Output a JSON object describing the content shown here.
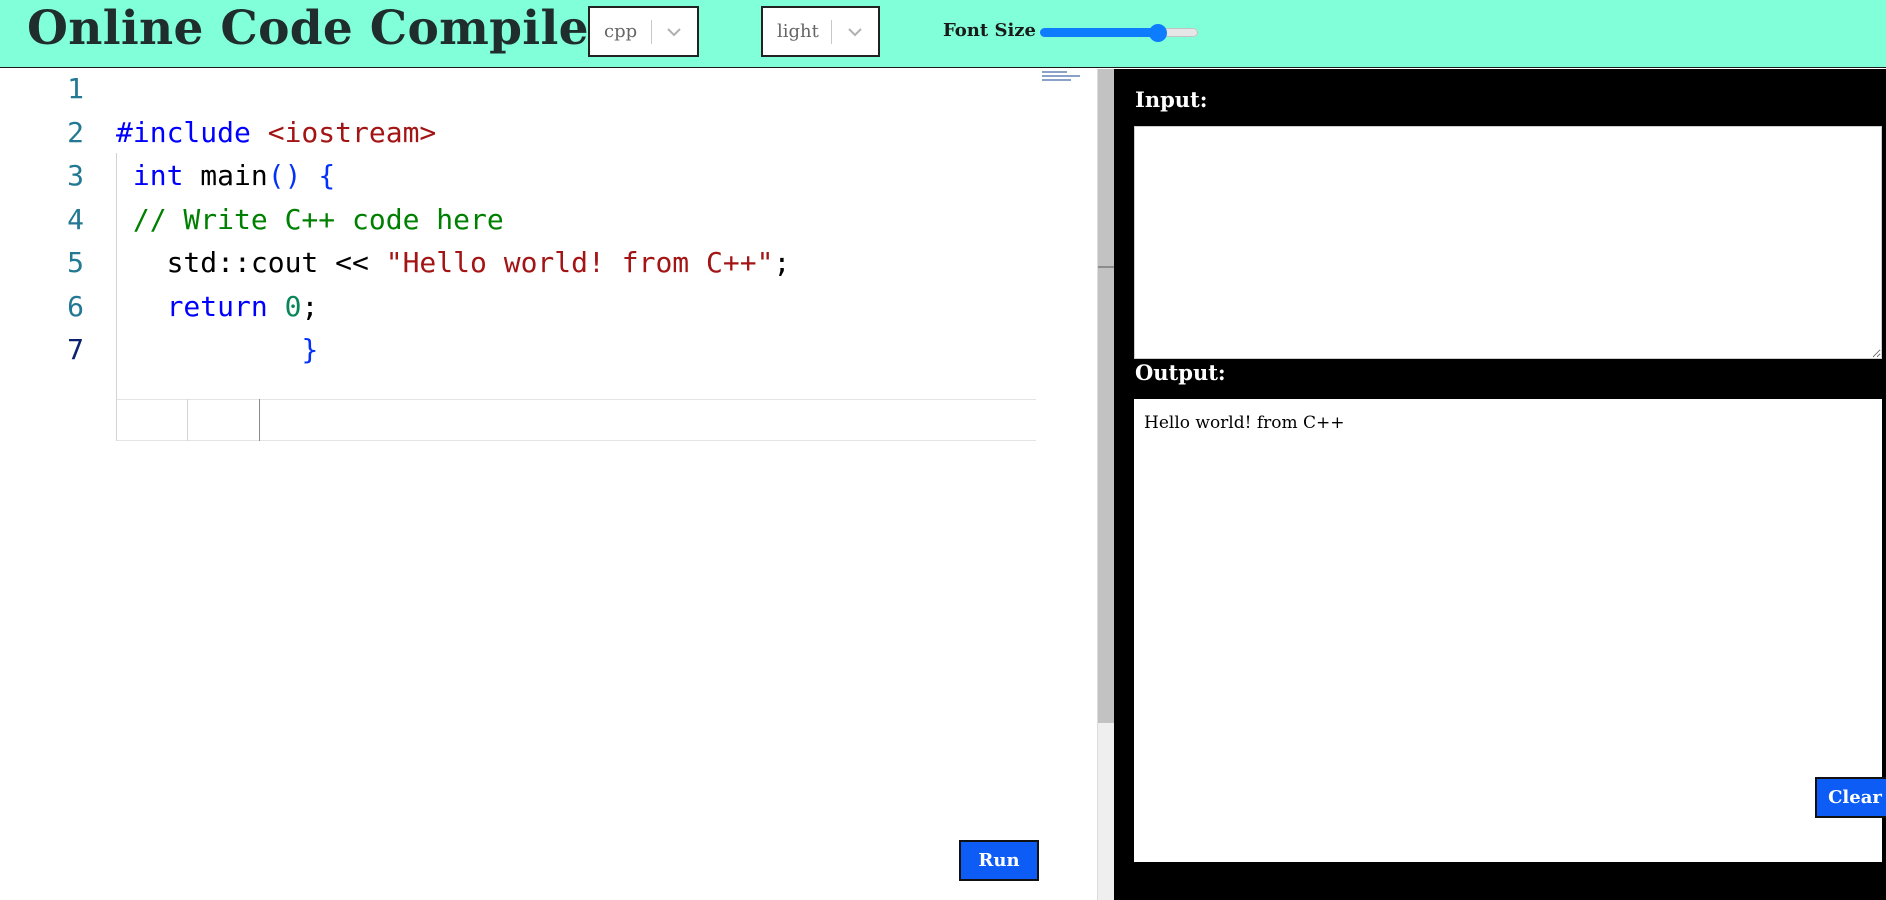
{
  "header": {
    "title": "Online Code Compiler",
    "language_select": {
      "value": "cpp"
    },
    "theme_select": {
      "value": "light"
    },
    "font_size": {
      "label": "Font Size",
      "value_fraction": 0.78
    }
  },
  "editor": {
    "line_numbers": [
      "1",
      "2",
      "3",
      "4",
      "5",
      "6",
      "7"
    ],
    "active_line": 7,
    "lines": [
      [],
      [
        {
          "t": "#include ",
          "c": "kw"
        },
        {
          "t": "<iostream>",
          "c": "str"
        }
      ],
      [
        {
          "t": " "
        },
        {
          "t": "int",
          "c": "kw"
        },
        {
          "t": " main"
        },
        {
          "t": "()",
          "c": "br"
        },
        {
          "t": " "
        },
        {
          "t": "{",
          "c": "br"
        }
      ],
      [
        {
          "t": " // Write C++ code here",
          "c": "cmt"
        }
      ],
      [
        {
          "t": "   std::cout << "
        },
        {
          "t": "\"Hello world! from C++\"",
          "c": "str"
        },
        {
          "t": ";"
        }
      ],
      [
        {
          "t": "   "
        },
        {
          "t": "return",
          "c": "kw"
        },
        {
          "t": " "
        },
        {
          "t": "0",
          "c": "num"
        },
        {
          "t": ";"
        }
      ],
      [
        {
          "t": "           "
        },
        {
          "t": "}",
          "c": "br"
        }
      ]
    ],
    "run_label": "Run"
  },
  "io": {
    "input_label": "Input:",
    "input_value": "",
    "output_label": "Output:",
    "output_text": "Hello world! from C++",
    "clear_label": "Clear"
  },
  "colors": {
    "header_bg": "#80ffd8",
    "button_bg": "#0d5cf6",
    "slider_accent": "#0d7cff",
    "keyword": "#0000ff",
    "string": "#a31515",
    "comment": "#008000",
    "number": "#098658",
    "bracket": "#0431fa",
    "line_number": "#237893"
  },
  "icons": {
    "select_chevron": "chevron-down-icon",
    "resize_handle": "resize-grip-icon"
  }
}
